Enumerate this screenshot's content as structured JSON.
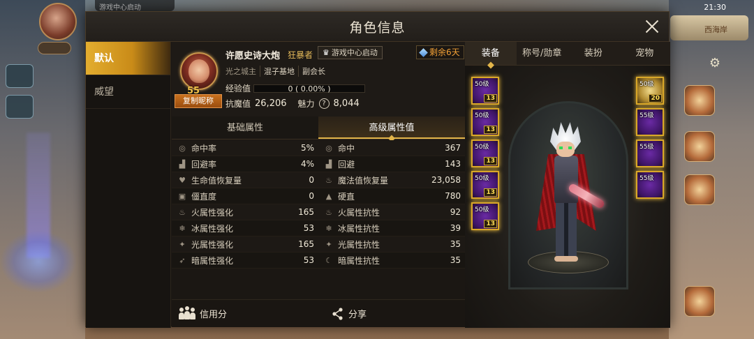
{
  "background": {
    "top_bar_text": "游戏中心启动",
    "clock": "21:30",
    "map_label": "西海岸"
  },
  "dialog": {
    "title": "角色信息",
    "side_tabs": [
      {
        "label": "默认",
        "active": true
      },
      {
        "label": "威望",
        "active": false
      }
    ]
  },
  "profile": {
    "level": "55",
    "copy_nickname_label": "复制昵称",
    "name": "许愿史诗大炮",
    "class": "狂暴者",
    "launch_badge": "游戏中心启动",
    "vip_remaining": "剩余6天",
    "title_line": [
      "光之城主",
      "混子基地",
      "副会长"
    ],
    "exp_label": "经验值",
    "exp_text": "0 ( 0.00% )",
    "exp_progress": 0,
    "anti_magic_label": "抗魔值",
    "anti_magic_value": "26,206",
    "charm_label": "魅力",
    "charm_value": "8,044"
  },
  "attr_tabs": [
    {
      "label": "基础属性",
      "active": false
    },
    {
      "label": "高级属性值",
      "active": true
    }
  ],
  "attributes": [
    {
      "left_label": "命中率",
      "left_value": "5%",
      "right_label": "命中",
      "right_value": "367",
      "left_icon": "target-icon",
      "right_icon": "target-icon"
    },
    {
      "left_label": "回避率",
      "left_value": "4%",
      "right_label": "回避",
      "right_value": "143",
      "left_icon": "boot-icon",
      "right_icon": "boot-icon"
    },
    {
      "left_label": "生命值恢复量",
      "left_value": "0",
      "right_label": "魔法值恢复量",
      "right_value": "23,058",
      "left_icon": "heart-icon",
      "right_icon": "potion-icon"
    },
    {
      "left_label": "僵直度",
      "left_value": "0",
      "right_label": "硬直",
      "right_value": "780",
      "left_icon": "stun-icon",
      "right_icon": "stagger-icon"
    },
    {
      "left_label": "火属性强化",
      "left_value": "165",
      "right_label": "火属性抗性",
      "right_value": "92",
      "left_icon": "fire-icon",
      "right_icon": "fire-icon"
    },
    {
      "left_label": "冰属性强化",
      "left_value": "53",
      "right_label": "冰属性抗性",
      "right_value": "39",
      "left_icon": "snowflake-icon",
      "right_icon": "snowflake-icon"
    },
    {
      "left_label": "光属性强化",
      "left_value": "165",
      "right_label": "光属性抗性",
      "right_value": "35",
      "left_icon": "light-icon",
      "right_icon": "light-icon"
    },
    {
      "left_label": "暗属性强化",
      "left_value": "53",
      "right_label": "暗属性抗性",
      "right_value": "35",
      "left_icon": "dark-bird-icon",
      "right_icon": "moon-icon"
    }
  ],
  "bottom": {
    "credit_label": "信用分",
    "share_label": "分享"
  },
  "char_tabs": [
    {
      "label": "装备",
      "active": true
    },
    {
      "label": "称号/勋章",
      "active": false
    },
    {
      "label": "装扮",
      "active": false
    },
    {
      "label": "宠物",
      "active": false
    }
  ],
  "equipment_left": [
    {
      "level": "50级",
      "badge": "13"
    },
    {
      "level": "50级",
      "badge": "13"
    },
    {
      "level": "50级",
      "badge": "13"
    },
    {
      "level": "50级",
      "badge": "13"
    },
    {
      "level": "50级",
      "badge": "13"
    }
  ],
  "equipment_right": [
    {
      "level": "50级",
      "badge": "20"
    },
    {
      "level": "55级",
      "badge": ""
    },
    {
      "level": "55级",
      "badge": ""
    },
    {
      "level": "55级",
      "badge": ""
    }
  ]
}
